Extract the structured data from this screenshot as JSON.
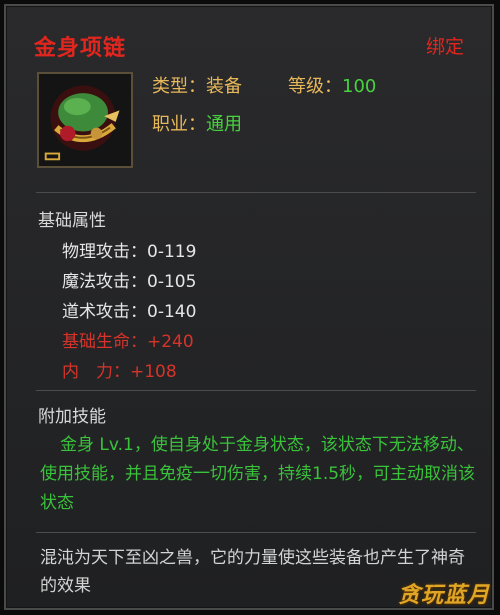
{
  "item": {
    "name": "金身项链",
    "bind_status": "绑定",
    "type_label": "类型：",
    "type_value": "装备",
    "level_label": "等级：",
    "level_value": "100",
    "class_label": "职业：",
    "class_value": "通用",
    "icon": "necklace-icon"
  },
  "base_attributes": {
    "title": "基础属性",
    "stats": [
      {
        "label": "物理攻击",
        "value": "0-119"
      },
      {
        "label": "魔法攻击",
        "value": "0-105"
      },
      {
        "label": "道术攻击",
        "value": "0-140"
      },
      {
        "label": "基础生命",
        "value": "+240"
      },
      {
        "label": "内　力",
        "value": "+108"
      }
    ]
  },
  "skill": {
    "title": "附加技能",
    "text": "金身 Lv.1，使自身处于金身状态，该状态下无法移动、使用技能，并且免疫一切伤害，持续1.5秒，可主动取消该状态"
  },
  "lore": "混沌为天下至凶之兽，它的力量使这些装备也产生了神奇的效果",
  "watermark": "贪玩蓝月",
  "colors": {
    "item_name": "#e0261e",
    "bind": "#e0261e",
    "label": "#e7b85a",
    "value_green": "#48d23e",
    "stat_red": "#d6342a",
    "skill_green": "#39c23a"
  }
}
